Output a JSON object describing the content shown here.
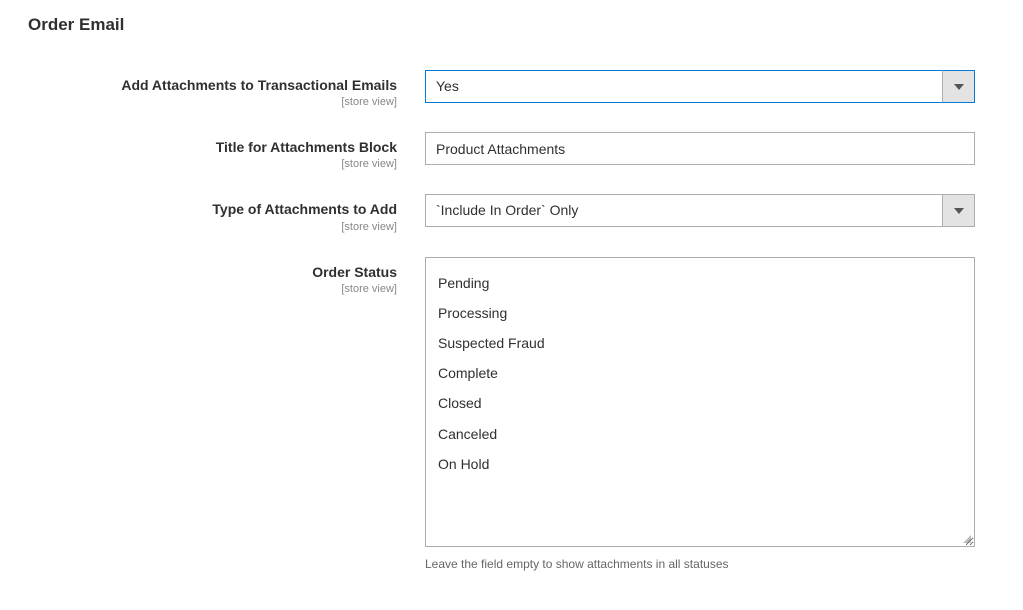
{
  "section_title": "Order Email",
  "scope_label": "[store view]",
  "fields": {
    "add_attachments": {
      "label": "Add Attachments to Transactional Emails",
      "value": "Yes"
    },
    "title_block": {
      "label": "Title for Attachments Block",
      "value": "Product Attachments"
    },
    "type_attachments": {
      "label": "Type of Attachments to Add",
      "value": "`Include In Order` Only"
    },
    "order_status": {
      "label": "Order Status",
      "options": [
        "Pending",
        "Processing",
        "Suspected Fraud",
        "Complete",
        "Closed",
        "Canceled",
        "On Hold"
      ],
      "note": "Leave the field empty to show attachments in all statuses"
    }
  }
}
